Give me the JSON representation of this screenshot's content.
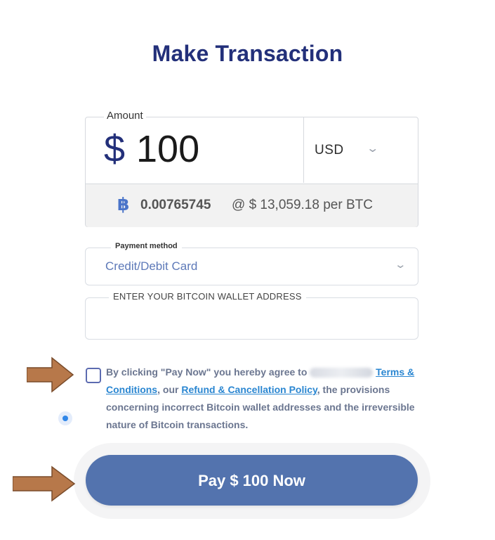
{
  "page": {
    "title": "Make Transaction"
  },
  "amount": {
    "legend": "Amount",
    "currency_symbol": "$",
    "value": "100",
    "currency": "USD",
    "btc_icon": "฿",
    "btc_amount": "0.00765745",
    "btc_rate": "@ $ 13,059.18 per BTC"
  },
  "payment_method": {
    "legend": "Payment method",
    "selected": "Credit/Debit Card"
  },
  "wallet": {
    "legend": "ENTER YOUR BITCOIN WALLET ADDRESS",
    "value": ""
  },
  "terms": {
    "checked": false,
    "text_before": "By clicking \"Pay Now\" you hereby agree to",
    "terms_link": "Terms & Conditions",
    "text_middle": ", our",
    "refund_link": "Refund & Cancellation Policy",
    "text_after": ", the provisions concerning incorrect Bitcoin wallet addresses and the irreversible nature of Bitcoin transactions."
  },
  "pay_button": {
    "label": "Pay $ 100 Now"
  },
  "icons": {
    "currency_dropdown": "chevron-down-icon",
    "payment_dropdown": "chevron-down-icon",
    "annotation_arrows": "arrow-right-icon"
  },
  "colors": {
    "title": "#23307a",
    "pay_button": "#5373ae",
    "link": "#2a86d1",
    "btc_icon": "#4a74c9",
    "arrow": "#b7784a"
  }
}
